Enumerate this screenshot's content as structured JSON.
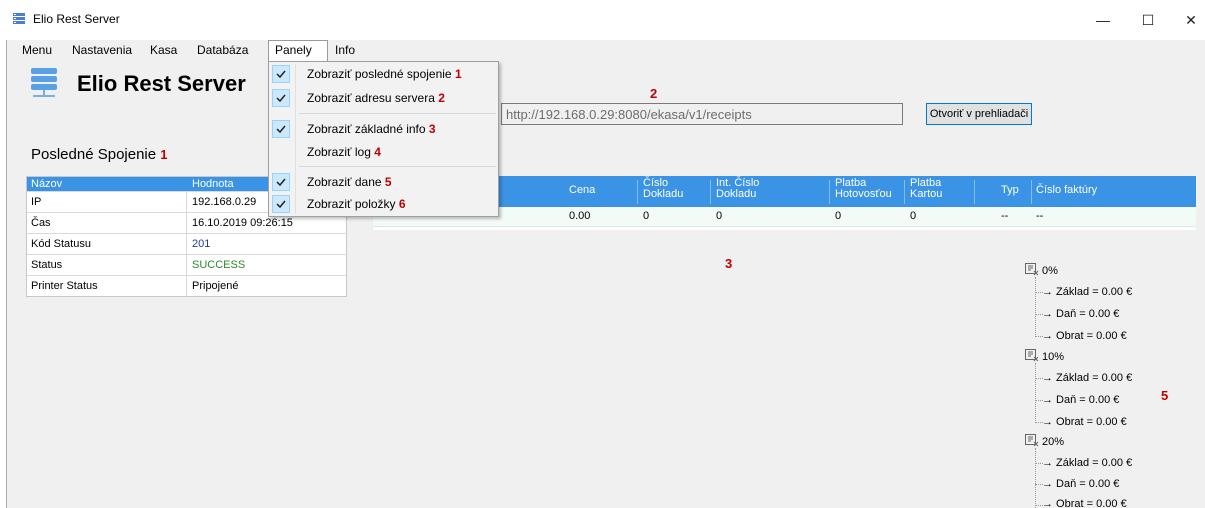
{
  "window": {
    "title": "Elio Rest Server",
    "minimize": "—",
    "maximize": "☐",
    "close": "✕"
  },
  "menubar": {
    "items": [
      "Menu",
      "Nastavenia",
      "Kasa",
      "Databáza",
      "Panely",
      "Info"
    ]
  },
  "header": {
    "title": "Elio Rest Server",
    "url": "http://192.168.0.29:8080/ekasa/v1/receipts",
    "open_button": "Otvoriť v prehliadači"
  },
  "panels_menu": {
    "items": [
      {
        "label": "Zobraziť posledné spojenie",
        "marker": "1",
        "checked": true
      },
      {
        "label": "Zobraziť adresu servera",
        "marker": "2",
        "checked": true
      },
      {
        "label": "Zobraziť základné info",
        "marker": "3",
        "checked": true
      },
      {
        "label": "Zobraziť log",
        "marker": "4",
        "checked": false
      },
      {
        "label": "Zobraziť dane",
        "marker": "5",
        "checked": true
      },
      {
        "label": "Zobraziť položky",
        "marker": "6",
        "checked": true
      }
    ]
  },
  "last_connection": {
    "title": "Posledné Spojenie",
    "marker": "1",
    "columns": [
      "Názov",
      "Hodnota"
    ],
    "rows": [
      {
        "name": "IP",
        "value": "192.168.0.29",
        "color": "#000000"
      },
      {
        "name": "Čas",
        "value": "16.10.2019 09:26:15",
        "color": "#000000"
      },
      {
        "name": "Kód Statusu",
        "value": "201",
        "color": "#1f3a9a"
      },
      {
        "name": "Status",
        "value": "SUCCESS",
        "color": "#2e8b2e"
      },
      {
        "name": "Printer Status",
        "value": "Pripojené",
        "color": "#000000"
      }
    ]
  },
  "markers": {
    "url": "2",
    "info": "3",
    "taxes": "5"
  },
  "receipt_table": {
    "columns": [
      "Cena",
      "Číslo Dokladu",
      "Int. Číslo Dokladu",
      "Platba Hotovosťou",
      "Platba Kartou",
      "Typ",
      "Číslo faktúry"
    ],
    "row": [
      "",
      "0.00",
      "0",
      "0",
      "0",
      "0",
      "--",
      "--"
    ]
  },
  "taxes": {
    "groups": [
      {
        "rate": "0%",
        "items": [
          "→ Základ = 0.00 €",
          "→ Daň = 0.00 €",
          "→ Obrat = 0.00 €"
        ]
      },
      {
        "rate": "10%",
        "items": [
          "→ Základ = 0.00 €",
          "→ Daň = 0.00 €",
          "→ Obrat = 0.00 €"
        ]
      },
      {
        "rate": "20%",
        "items": [
          "→ Základ = 0.00 €",
          "→ Daň = 0.00 €",
          "→ Obrat = 0.00 €"
        ]
      }
    ]
  },
  "colors": {
    "accent": "#3b93e5",
    "marker": "#c00000",
    "success": "#2e8b2e"
  },
  "icons": {
    "app": "server-icon",
    "check": "check-icon",
    "tax_group": "tax-group-icon"
  }
}
